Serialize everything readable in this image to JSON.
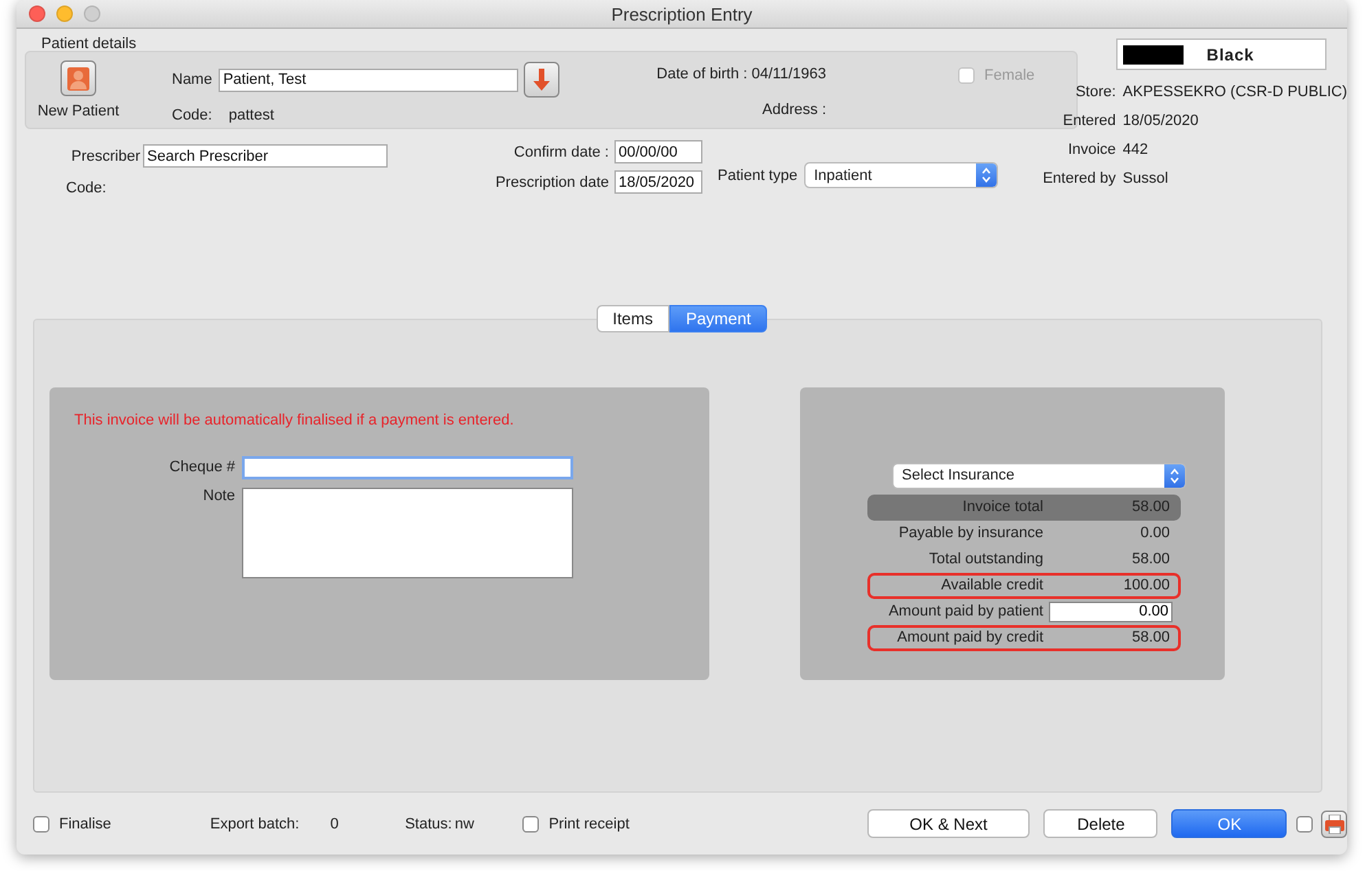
{
  "window": {
    "title": "Prescription Entry"
  },
  "patient": {
    "section_label": "Patient details",
    "new_patient_label": "New Patient",
    "name_label": "Name",
    "name_value": "Patient, Test",
    "code_label": "Code:",
    "code_value": "pattest",
    "dob": "Date of birth : 04/11/1963",
    "address_label": "Address :",
    "female": {
      "label": "Female",
      "checked": false,
      "disabled": true
    }
  },
  "prescriber": {
    "label": "Prescriber",
    "value": "Search Prescriber",
    "code_label": "Code:"
  },
  "dates": {
    "confirm_label": "Confirm date :",
    "confirm_value": "00/00/00",
    "prescription_label": "Prescription date",
    "prescription_value": "18/05/2020",
    "patient_type_label": "Patient type",
    "patient_type_value": "Inpatient"
  },
  "store_badge": {
    "label": "Black"
  },
  "info": [
    {
      "label": "Store:",
      "value": "AKPESSEKRO (CSR-D PUBLIC)"
    },
    {
      "label": "Entered",
      "value": "18/05/2020"
    },
    {
      "label": "Invoice",
      "value": "442"
    },
    {
      "label": "Entered by",
      "value": "Sussol"
    }
  ],
  "tabs": [
    {
      "label": "Items",
      "selected": false
    },
    {
      "label": "Payment",
      "selected": true
    }
  ],
  "payment": {
    "warning": "This invoice will be automatically finalised if a payment is entered.",
    "cheque_label": "Cheque #",
    "note_label": "Note"
  },
  "insurance": {
    "select_value": "Select Insurance",
    "rows": [
      {
        "kind": "total",
        "label": "Invoice total",
        "value": "58.00",
        "highlighted": false
      },
      {
        "kind": "plain",
        "label": "Payable by insurance",
        "value": "0.00",
        "highlighted": false
      },
      {
        "kind": "plain",
        "label": "Total outstanding",
        "value": "58.00",
        "highlighted": false
      },
      {
        "kind": "plain",
        "label": "Available credit",
        "value": "100.00",
        "highlighted": true
      },
      {
        "kind": "input",
        "label": "Amount paid by patient",
        "value": "0.00",
        "highlighted": false
      },
      {
        "kind": "plain",
        "label": "Amount paid by credit",
        "value": "58.00",
        "highlighted": true
      }
    ]
  },
  "footer": {
    "finalise": {
      "label": "Finalise",
      "checked": false
    },
    "export_label": "Export batch:",
    "export_value": "0",
    "status_label": "Status:",
    "status_value": "nw",
    "print_receipt": {
      "label": "Print receipt",
      "checked": false
    },
    "buttons": [
      {
        "label": "OK & Next",
        "kind": "normal"
      },
      {
        "label": "Delete",
        "kind": "normal"
      },
      {
        "label": "OK",
        "kind": "default"
      }
    ],
    "extra_checkbox": {
      "checked": false
    }
  }
}
